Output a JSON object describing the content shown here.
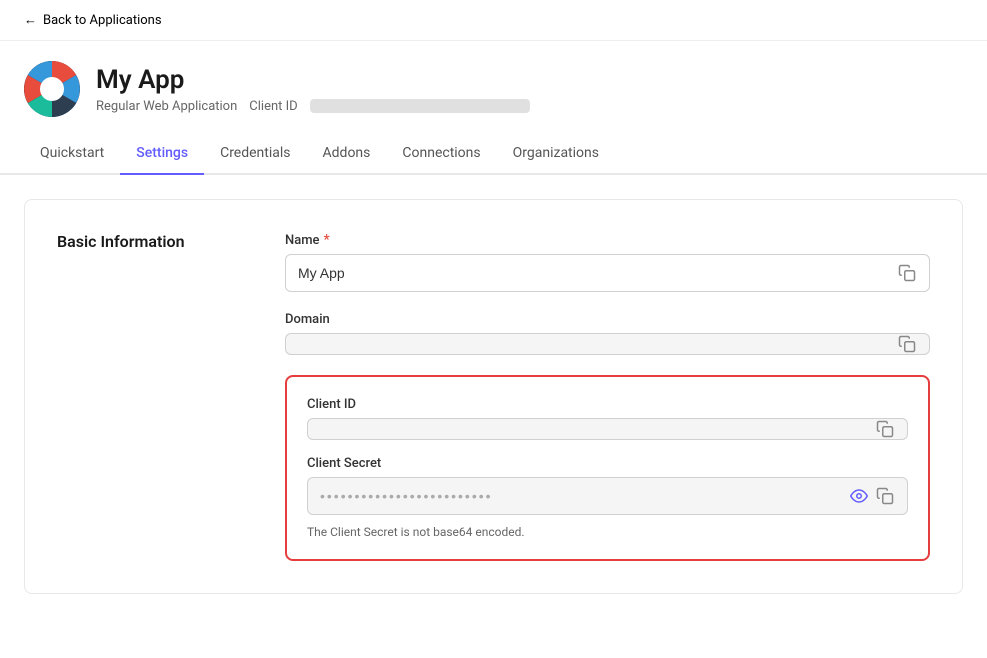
{
  "backLink": {
    "label": "Back to Applications",
    "arrow": "←"
  },
  "app": {
    "name": "My App",
    "type": "Regular Web Application",
    "clientIdLabel": "Client ID",
    "clientIdBlurred": true
  },
  "tabs": [
    {
      "id": "quickstart",
      "label": "Quickstart",
      "active": false
    },
    {
      "id": "settings",
      "label": "Settings",
      "active": true
    },
    {
      "id": "credentials",
      "label": "Credentials",
      "active": false
    },
    {
      "id": "addons",
      "label": "Addons",
      "active": false
    },
    {
      "id": "connections",
      "label": "Connections",
      "active": false
    },
    {
      "id": "organizations",
      "label": "Organizations",
      "active": false
    }
  ],
  "section": {
    "label": "Basic Information",
    "fields": {
      "name": {
        "label": "Name",
        "required": true,
        "value": "My App",
        "placeholder": ""
      },
      "domain": {
        "label": "Domain",
        "required": false,
        "value": "",
        "blurred": true
      },
      "clientId": {
        "label": "Client ID",
        "blurred": true
      },
      "clientSecret": {
        "label": "Client Secret",
        "hint": "The Client Secret is not base64 encoded.",
        "isPassword": true
      }
    }
  },
  "icons": {
    "copy": "⧉",
    "eye": "👁"
  }
}
